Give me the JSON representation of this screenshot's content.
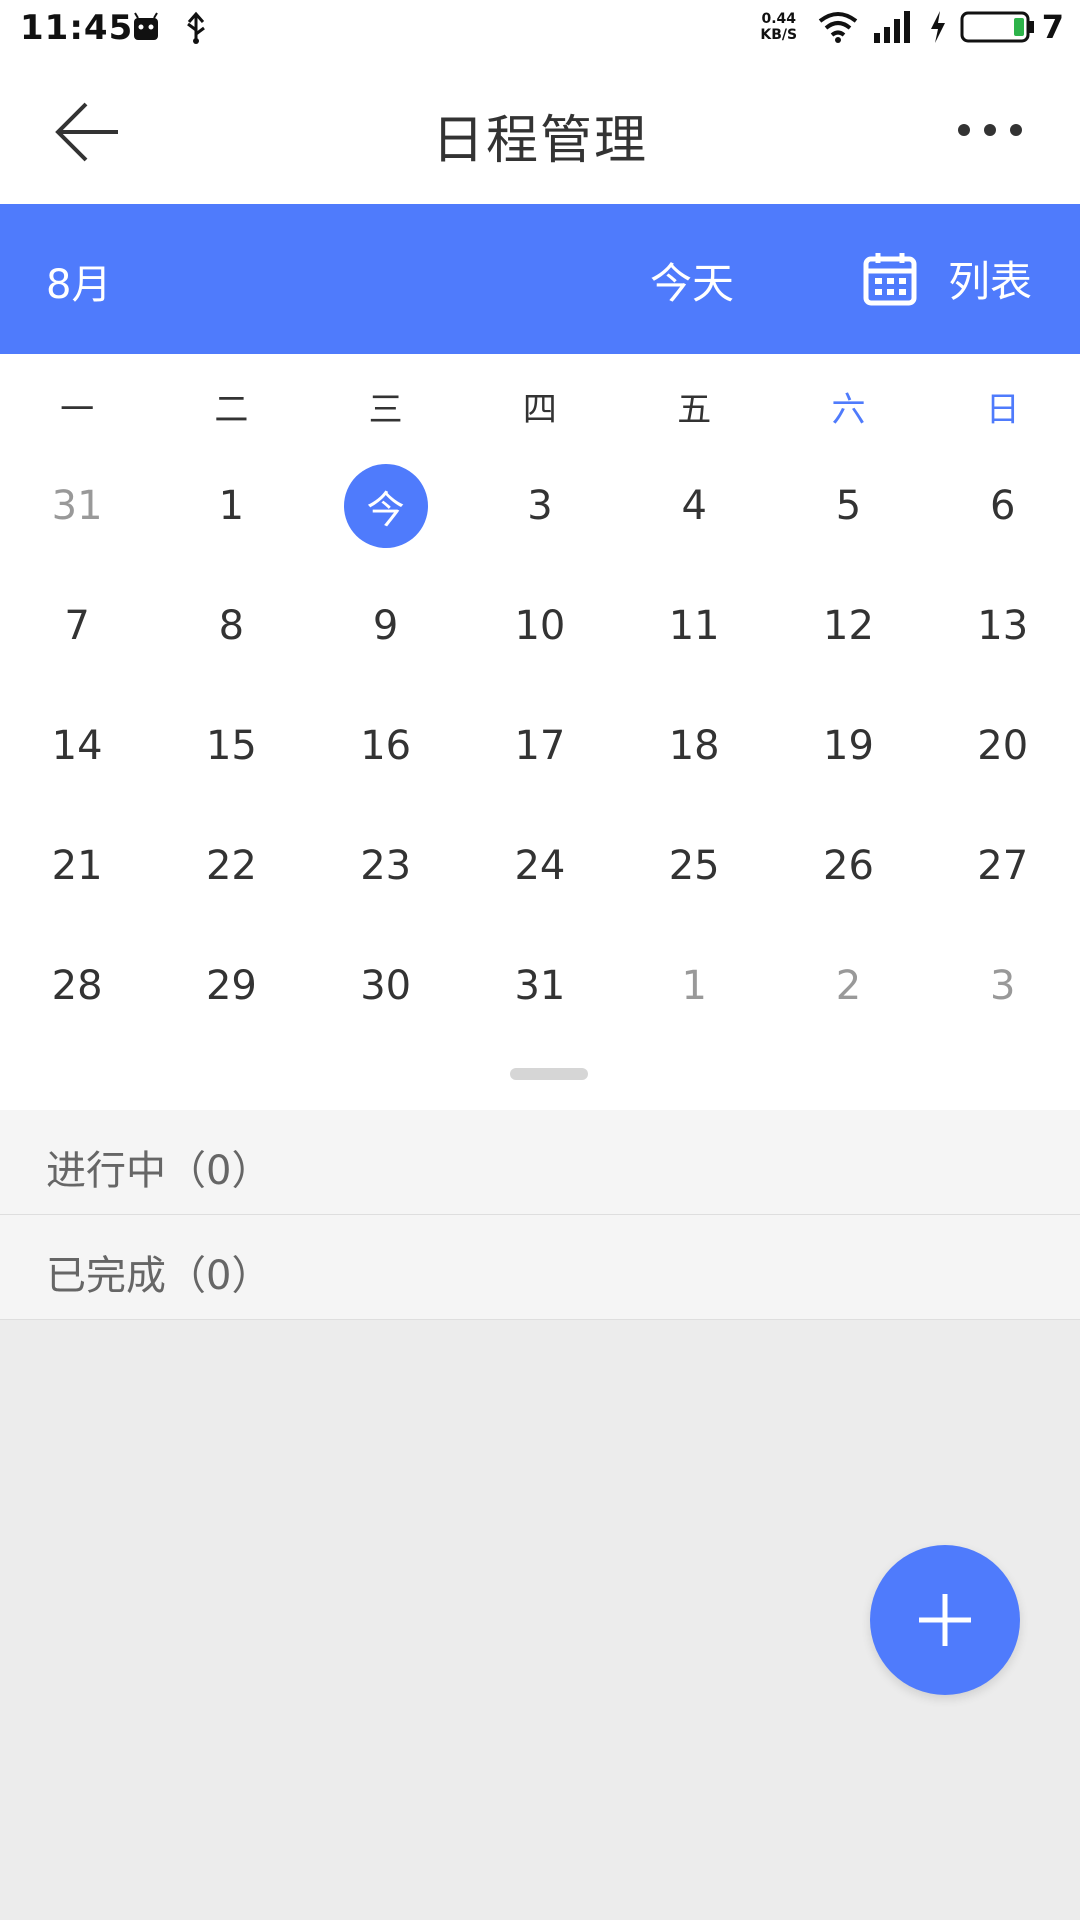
{
  "status_bar": {
    "time": "11:45",
    "net_speed_value": "0.44",
    "net_speed_unit": "KB/S",
    "battery_level": "7"
  },
  "header": {
    "title": "日程管理",
    "icons": {
      "back": "back-arrow-icon",
      "more": "more-icon"
    }
  },
  "calendar_header": {
    "month": "8月",
    "today_label": "今天",
    "list_label": "列表",
    "icon": "calendar-icon",
    "color": "#4f7bfc"
  },
  "weekdays": [
    "一",
    "二",
    "三",
    "四",
    "五",
    "六",
    "日"
  ],
  "weeks": [
    [
      {
        "d": "31",
        "outside": true
      },
      {
        "d": "1"
      },
      {
        "d": "今",
        "today": true
      },
      {
        "d": "3"
      },
      {
        "d": "4"
      },
      {
        "d": "5"
      },
      {
        "d": "6"
      }
    ],
    [
      {
        "d": "7"
      },
      {
        "d": "8"
      },
      {
        "d": "9"
      },
      {
        "d": "10"
      },
      {
        "d": "11"
      },
      {
        "d": "12"
      },
      {
        "d": "13"
      }
    ],
    [
      {
        "d": "14"
      },
      {
        "d": "15"
      },
      {
        "d": "16"
      },
      {
        "d": "17"
      },
      {
        "d": "18"
      },
      {
        "d": "19"
      },
      {
        "d": "20"
      }
    ],
    [
      {
        "d": "21"
      },
      {
        "d": "22"
      },
      {
        "d": "23"
      },
      {
        "d": "24"
      },
      {
        "d": "25"
      },
      {
        "d": "26"
      },
      {
        "d": "27"
      }
    ],
    [
      {
        "d": "28"
      },
      {
        "d": "29"
      },
      {
        "d": "30"
      },
      {
        "d": "31"
      },
      {
        "d": "1",
        "outside": true
      },
      {
        "d": "2",
        "outside": true
      },
      {
        "d": "3",
        "outside": true
      }
    ]
  ],
  "sections": {
    "in_progress": "进行中（0）",
    "completed": "已完成（0）"
  },
  "fab": {
    "icon": "plus-icon"
  }
}
